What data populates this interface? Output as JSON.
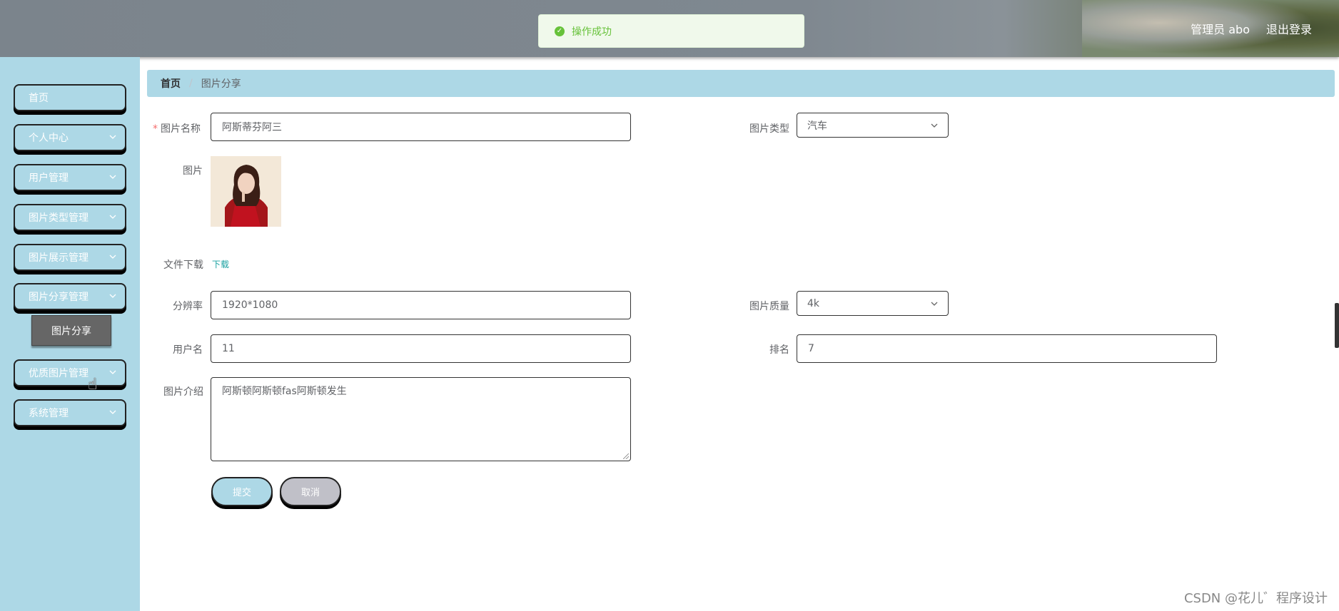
{
  "header": {
    "user_label": "管理员 abo",
    "logout_label": "退出登录"
  },
  "toast": {
    "message": "操作成功",
    "icon": "check-circle-icon",
    "color": "#67c23a"
  },
  "sidebar": {
    "items": [
      {
        "label": "首页",
        "has_chevron": false
      },
      {
        "label": "个人中心",
        "has_chevron": true
      },
      {
        "label": "用户管理",
        "has_chevron": true
      },
      {
        "label": "图片类型管理",
        "has_chevron": true
      },
      {
        "label": "图片展示管理",
        "has_chevron": true
      },
      {
        "label": "图片分享管理",
        "has_chevron": true
      },
      {
        "label": "优质图片管理",
        "has_chevron": true
      },
      {
        "label": "系统管理",
        "has_chevron": true
      }
    ],
    "submenu": {
      "label": "图片分享"
    }
  },
  "breadcrumb": {
    "home": "首页",
    "separator": "/",
    "current": "图片分享"
  },
  "form": {
    "name": {
      "label": "图片名称",
      "required_mark": "*",
      "value": "阿斯蒂芬阿三"
    },
    "type": {
      "label": "图片类型",
      "value": "汽车"
    },
    "image": {
      "label": "图片"
    },
    "file": {
      "label": "文件下载",
      "link": "下载"
    },
    "resolution": {
      "label": "分辨率",
      "value": "1920*1080"
    },
    "quality": {
      "label": "图片质量",
      "value": "4k"
    },
    "username": {
      "label": "用户名",
      "value": "11"
    },
    "rank": {
      "label": "排名",
      "value": "7"
    },
    "intro": {
      "label": "图片介绍",
      "value": "阿斯顿阿斯顿fas阿斯顿发生"
    },
    "submit_label": "提交",
    "cancel_label": "取消"
  },
  "watermark": "CSDN @花儿゛程序设计",
  "colors": {
    "sidebar_bg": "#add8e6",
    "header_bg": "#7f8890",
    "success": "#67c23a"
  }
}
